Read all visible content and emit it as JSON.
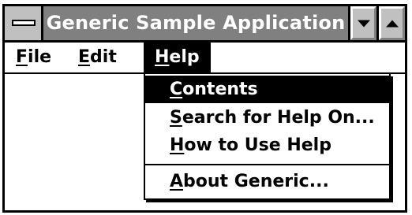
{
  "window": {
    "title": "Generic Sample Application"
  },
  "menubar": {
    "items": [
      {
        "label": "File",
        "accelerator": "F",
        "rest": "ile"
      },
      {
        "label": "Edit",
        "accelerator": "E",
        "rest": "dit"
      },
      {
        "label": "Help",
        "accelerator": "H",
        "rest": "elp",
        "open": true
      }
    ]
  },
  "help_menu": {
    "items": [
      {
        "label": "Contents",
        "accelerator": "C",
        "rest": "ontents",
        "selected": true
      },
      {
        "label": "Search for Help On...",
        "accelerator": "S",
        "rest": "earch for Help On..."
      },
      {
        "label": "How to Use Help",
        "accelerator": "H",
        "rest": "ow to Use Help"
      },
      {
        "label": "About Generic...",
        "accelerator": "A",
        "rest": "bout Generic..."
      }
    ]
  },
  "icons": {
    "system_menu": "system-menu-icon",
    "minimize": "minimize-arrow-down-icon",
    "maximize": "maximize-arrow-up-icon"
  },
  "colors": {
    "titlebar": "#808080",
    "buttons": "#c0c0c0",
    "highlight": "#000000",
    "highlight_text": "#ffffff"
  }
}
